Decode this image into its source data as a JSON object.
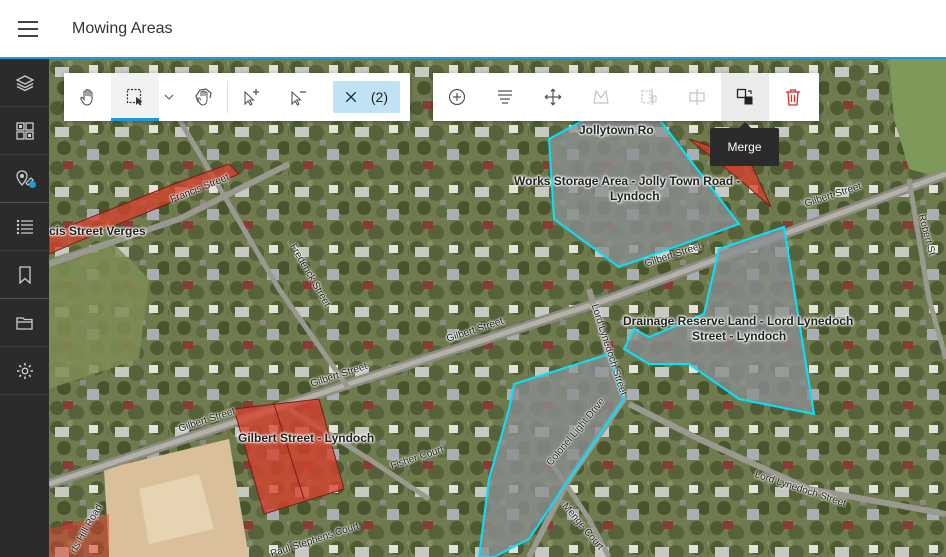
{
  "header": {
    "title": "Mowing Areas"
  },
  "rail": {
    "items": [
      {
        "name": "layers-icon"
      },
      {
        "name": "basemap-gallery-icon"
      },
      {
        "name": "edit-icon"
      },
      {
        "name": "legend-list-icon"
      },
      {
        "name": "bookmark-icon"
      },
      {
        "name": "folder-icon"
      },
      {
        "name": "settings-icon"
      }
    ]
  },
  "toolbar": {
    "selection_count": "(2)",
    "tooltip": "Merge"
  },
  "map": {
    "polygon_labels": {
      "jollytown": "Jollytown Ro",
      "works_storage_1": "Works Storage Area - Jolly Town Road -",
      "works_storage_2": "Lyndoch",
      "drainage_1": "Drainage Reserve Land - Lord Lynedoch",
      "drainage_2": "Street - Lyndoch",
      "gilbert": "Gilbert Street  - Lyndoch",
      "francis": "cis Street Verges"
    },
    "roads": {
      "francis_street": "Francis Street",
      "frederick_street": "Frederick Street",
      "gilbert_street": "Gilbert Street",
      "lord_lynedoch_street": "Lord Lynedoch Street",
      "colonel_light_drive": "Colonel Light Drive",
      "fisher_court": "Fisher Court",
      "menge_court": "Menge Court",
      "stephens_court": "Paul Stephens Court",
      "hill_road": "rts Hill Road",
      "robert_street": "Robert St"
    }
  },
  "colors": {
    "accent": "#1c9bd6",
    "selected_outline": "#00e5ff",
    "polygon_red": "#d9402e",
    "delete_red": "#d83020"
  }
}
